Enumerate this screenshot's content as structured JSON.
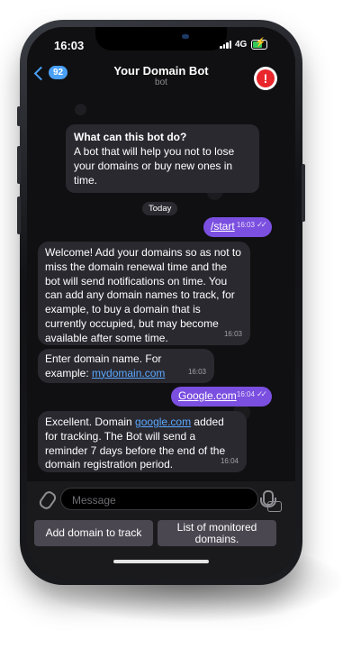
{
  "status_bar": {
    "time": "16:03",
    "network": "4G"
  },
  "header": {
    "back_count": "92",
    "title": "Your Domain Bot",
    "subtitle": "bot",
    "avatar_glyph": "!"
  },
  "info_card": {
    "title": "What can this bot do?",
    "text": "A bot that will help you not to lose your domains or buy new ones in time."
  },
  "date_separator": "Today",
  "messages": [
    {
      "side": "out",
      "link": "/start",
      "time": "16:03"
    },
    {
      "side": "in",
      "text": "Welcome! Add your domains so as not to miss the domain renewal time and the bot will send notifications on time. You can add any domain names to track, for example, to buy a domain that is currently occupied, but may become available after some time.",
      "time": "16:03"
    },
    {
      "side": "in",
      "text": "Enter domain name. For example: ",
      "link": "mydomain.com",
      "time": "16:03"
    },
    {
      "side": "out",
      "link": "Google.com",
      "time": "16:04"
    },
    {
      "side": "in",
      "text_before": "Excellent. Domain ",
      "link": "google.com",
      "text_after": " added for tracking. The Bot will send a reminder 7 days before the end of the domain registration period.",
      "time": "16:04"
    }
  ],
  "input": {
    "placeholder": "Message"
  },
  "keyboard": {
    "btn_add": "Add domain to track",
    "btn_list": "List of monitored domains."
  },
  "colors": {
    "accent": "#4aa0f7",
    "outgoing_bubble": "#7b4fe0",
    "incoming_bubble": "#2a2930",
    "link": "#5aa8ff"
  }
}
